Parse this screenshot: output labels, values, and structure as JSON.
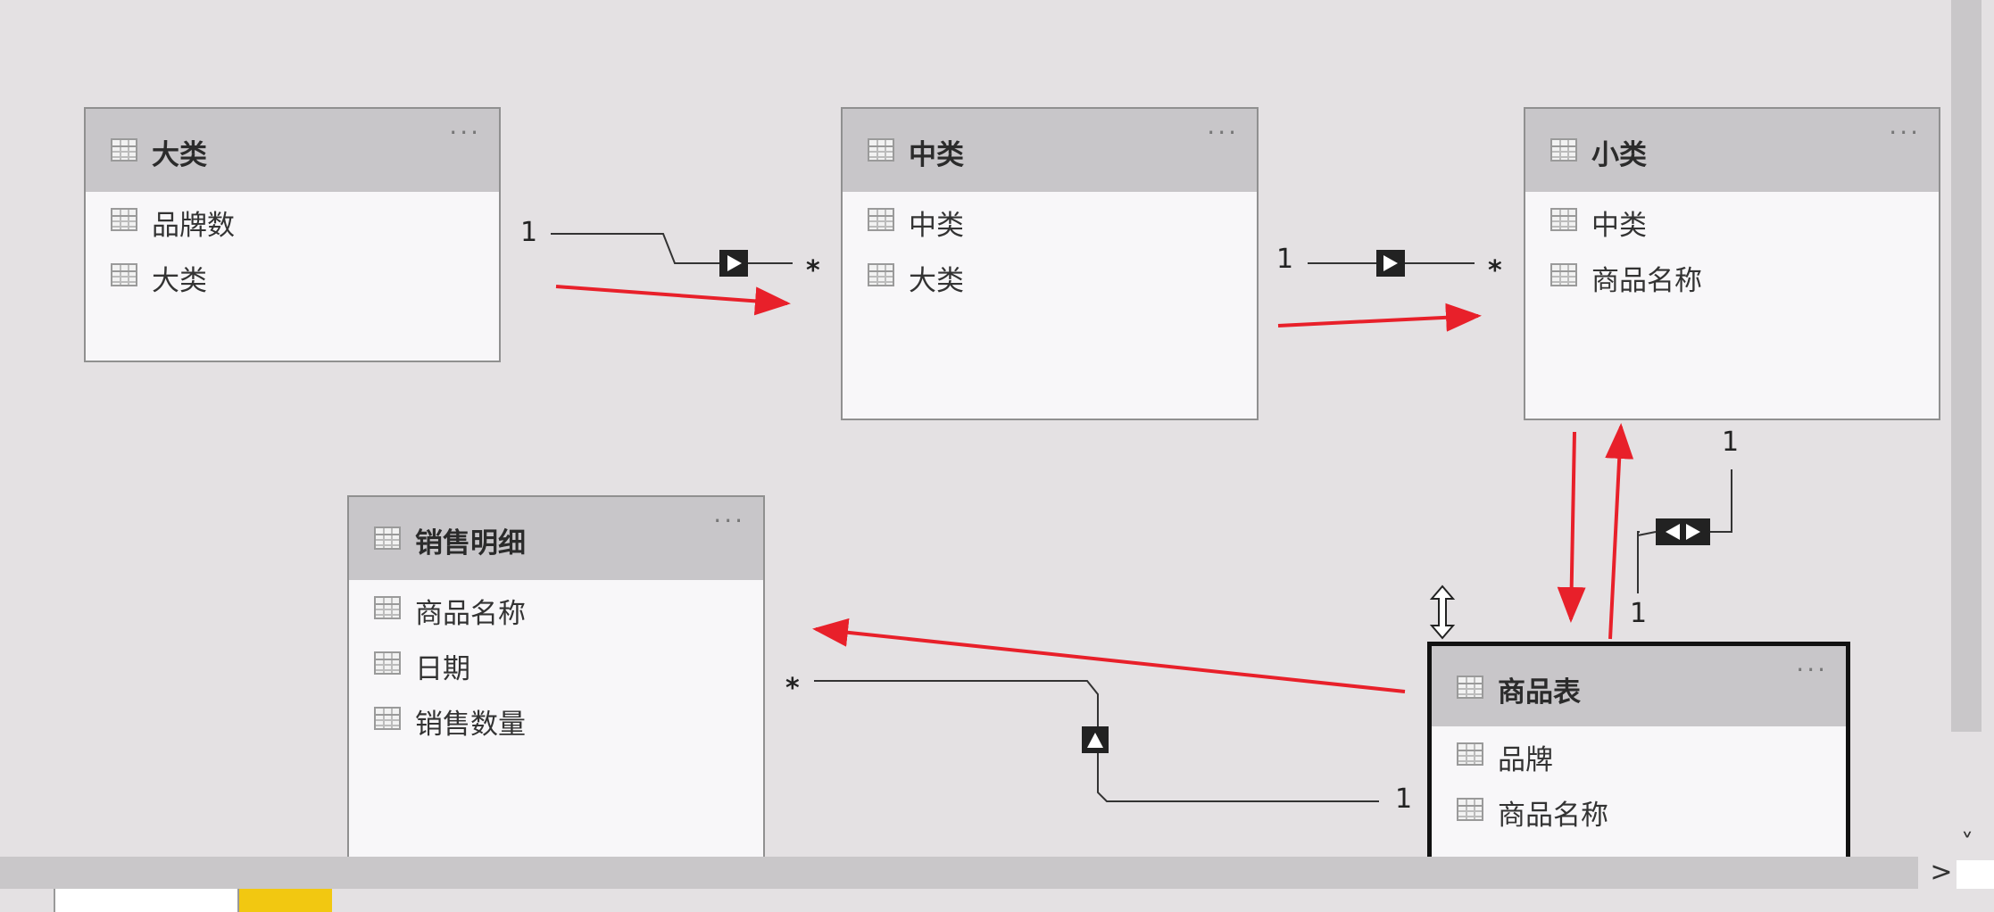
{
  "tables": [
    {
      "title": "大类",
      "fields": [
        "品牌数",
        "大类"
      ]
    },
    {
      "title": "中类",
      "fields": [
        "中类",
        "大类"
      ]
    },
    {
      "title": "小类",
      "fields": [
        "中类",
        "商品名称"
      ]
    },
    {
      "title": "销售明细",
      "fields": [
        "商品名称",
        "日期",
        "销售数量"
      ]
    },
    {
      "title": "商品表",
      "fields": [
        "品牌",
        "商品名称"
      ]
    }
  ],
  "more_label": "···",
  "relationships": [
    {
      "from_table": "大类",
      "to_table": "中类",
      "from_cardinality": "1",
      "to_cardinality": "*",
      "direction": "single"
    },
    {
      "from_table": "中类",
      "to_table": "小类",
      "from_cardinality": "1",
      "to_cardinality": "*",
      "direction": "single"
    },
    {
      "from_table": "小类",
      "to_table": "商品表",
      "from_cardinality": "1",
      "to_cardinality": "1",
      "direction": "both"
    },
    {
      "from_table": "商品表",
      "to_table": "销售明细",
      "from_cardinality": "1",
      "to_cardinality": "*",
      "direction": "single"
    }
  ],
  "scroll_right_glyph": ">",
  "scroll_down_glyph": "˅",
  "scroll_up_glyph": "˄",
  "colors": {
    "canvas": "#e4e1e3",
    "header": "#c8c6c9",
    "annotation_arrow": "#e8202a",
    "tab_accent": "#f2c811"
  }
}
